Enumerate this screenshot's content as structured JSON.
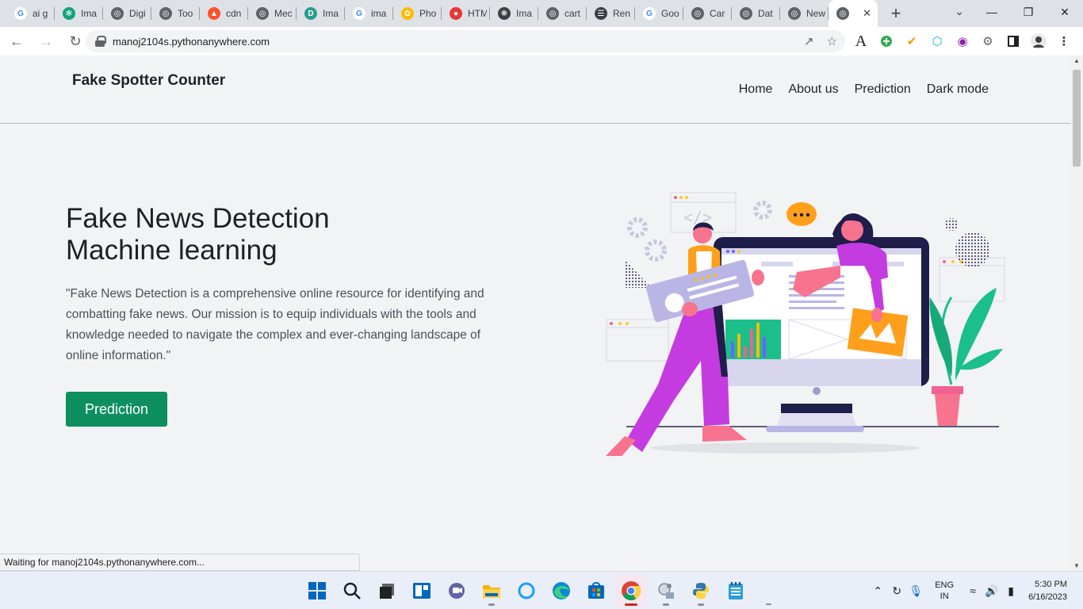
{
  "browser": {
    "tabs": [
      {
        "label": "ai g",
        "icon": "google-icon",
        "color": "#4285f4"
      },
      {
        "label": "Ima",
        "icon": "chatgpt-icon",
        "color": "#10a37f"
      },
      {
        "label": "Digi",
        "icon": "globe-icon",
        "color": "#5f6368"
      },
      {
        "label": "Too",
        "icon": "globe-icon",
        "color": "#5f6368"
      },
      {
        "label": "cdn",
        "icon": "brave-icon",
        "color": "#fb542b"
      },
      {
        "label": "Mec",
        "icon": "globe-icon",
        "color": "#5f6368"
      },
      {
        "label": "Ima",
        "icon": "d-icon",
        "color": "#2a9d8f"
      },
      {
        "label": "ima",
        "icon": "google-icon",
        "color": "#4285f4"
      },
      {
        "label": "Pho",
        "icon": "photos-icon",
        "color": "#fbbc05"
      },
      {
        "label": "HTM",
        "icon": "record-icon",
        "color": "#e53935"
      },
      {
        "label": "Ima",
        "icon": "bug-icon",
        "color": "#3c4043"
      },
      {
        "label": "cart",
        "icon": "globe-icon",
        "color": "#5f6368"
      },
      {
        "label": "Ren",
        "icon": "layers-icon",
        "color": "#3c4043"
      },
      {
        "label": "Goo",
        "icon": "google-icon",
        "color": "#4285f4"
      },
      {
        "label": "Car",
        "icon": "globe-icon",
        "color": "#5f6368"
      },
      {
        "label": "Dat",
        "icon": "globe-icon",
        "color": "#5f6368"
      },
      {
        "label": "New",
        "icon": "chrome-icon",
        "color": "#5f6368"
      },
      {
        "label": "",
        "icon": "globe-icon",
        "color": "#5f6368",
        "active": true
      }
    ],
    "url": "manoj2104s.pythonanywhere.com",
    "status_text": "Waiting for manoj2104s.pythonanywhere.com..."
  },
  "site": {
    "brand": "Fake Spotter Counter",
    "nav": [
      "Home",
      "About us",
      "Prediction",
      "Dark mode"
    ],
    "hero_title_line1": "Fake News Detection",
    "hero_title_line2": "Machine learning",
    "hero_text": "\"Fake News Detection is a comprehensive online resource for identifying and combatting fake news. Our mission is to equip individuals with the tools and knowledge needed to navigate the complex and ever-changing landscape of online information.\"",
    "cta_label": "Prediction",
    "accent_color": "#0e8f5f"
  },
  "taskbar": {
    "apps": [
      "windows-start-icon",
      "search-icon",
      "task-view-icon",
      "widgets-icon",
      "teams-chat-icon",
      "file-explorer-icon",
      "cortana-icon",
      "edge-icon",
      "store-icon",
      "chrome-icon",
      "app-icon",
      "python-icon",
      "notepad-icon"
    ],
    "lang_line1": "ENG",
    "lang_line2": "IN",
    "time": "5:30 PM",
    "date": "6/16/2023"
  }
}
